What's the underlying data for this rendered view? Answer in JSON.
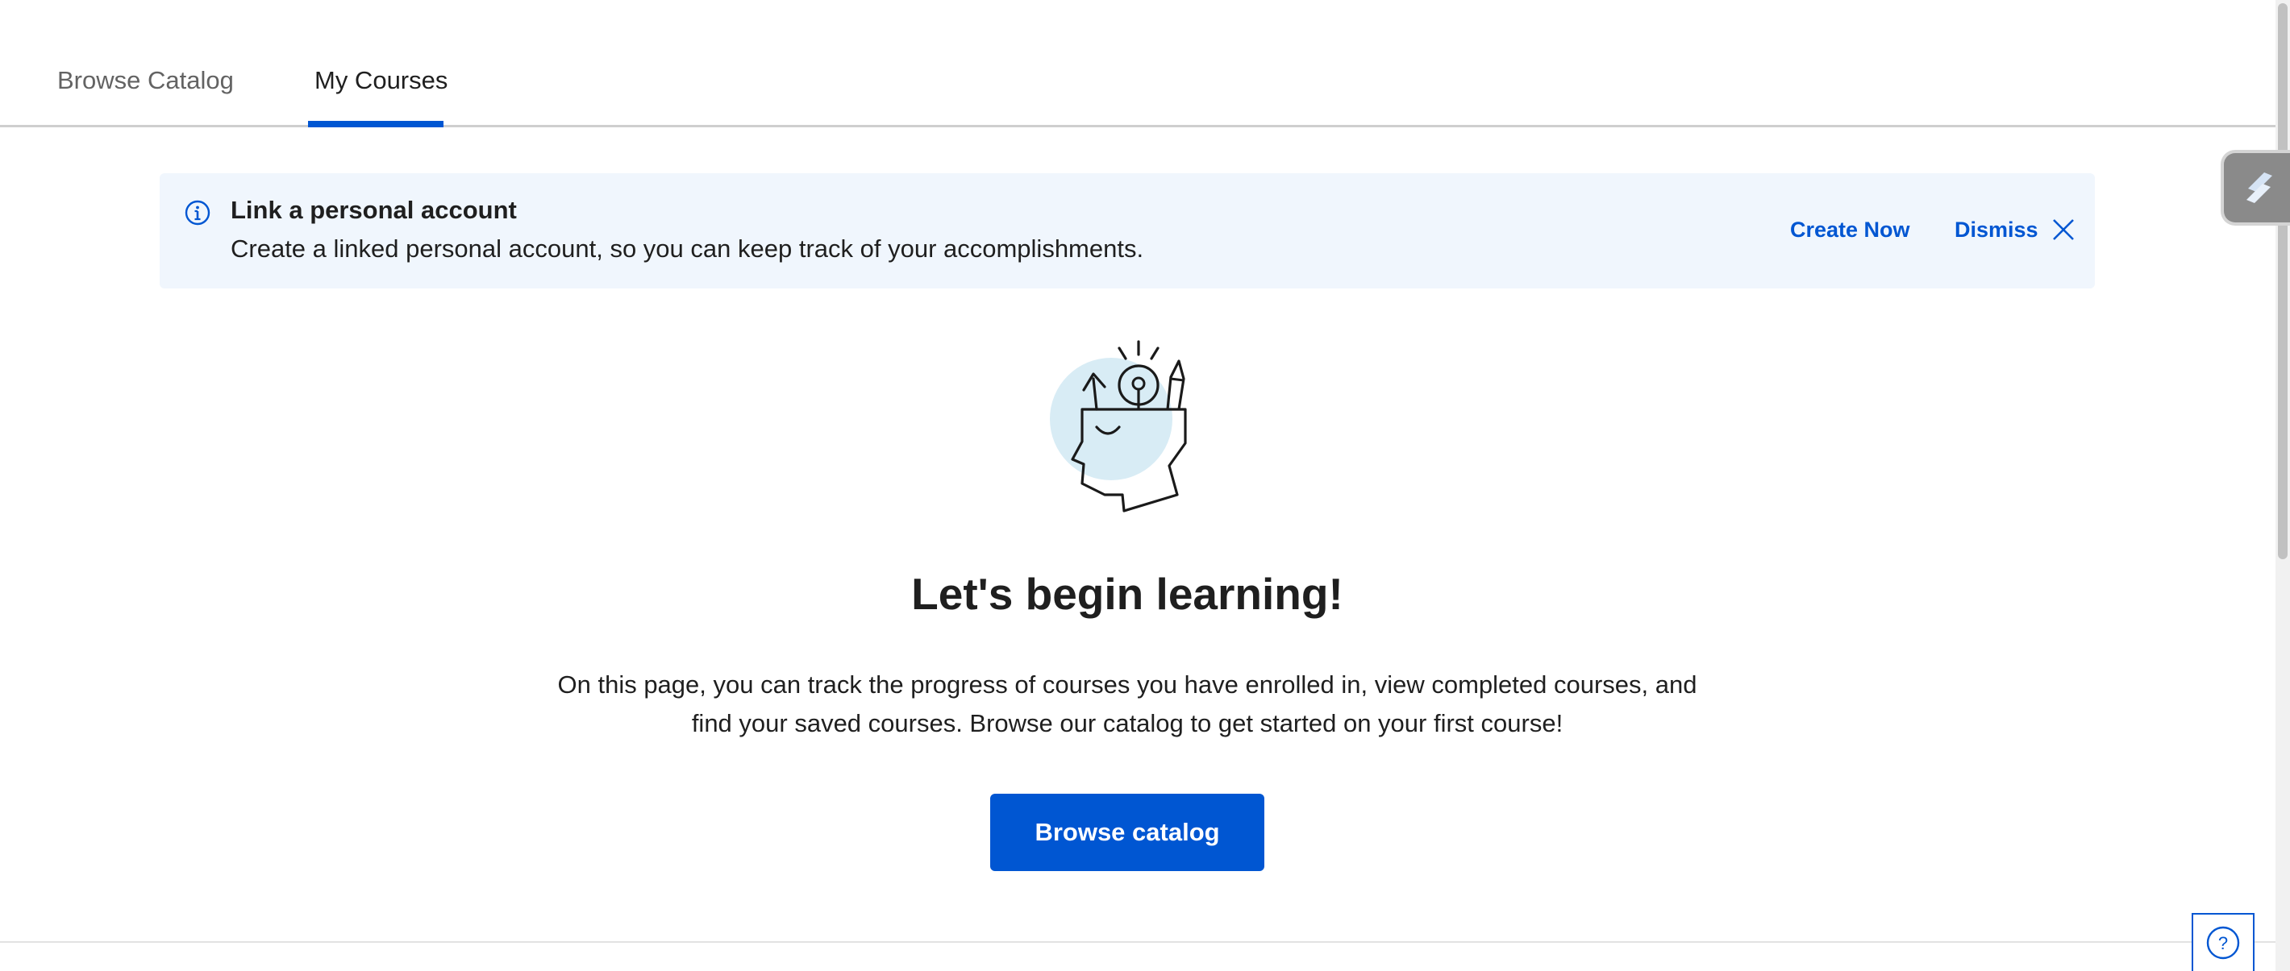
{
  "nav": {
    "tabs": [
      {
        "label": "Browse Catalog",
        "selected": false
      },
      {
        "label": "My Courses",
        "selected": true
      }
    ]
  },
  "banner": {
    "icon": "info-icon",
    "title": "Link a personal account",
    "text": "Create a linked personal account, so you can keep track of your accomplishments.",
    "create_label": "Create Now",
    "dismiss_label": "Dismiss",
    "close_icon": "close-icon"
  },
  "empty_state": {
    "illustration": "head-lightbulb-illustration",
    "heading": "Let's begin learning!",
    "description": "On this page, you can track the progress of courses you have enrolled in, view completed courses, and find your saved courses. Browse our catalog to get started on your first course!",
    "cta_label": "Browse catalog"
  },
  "help": {
    "icon": "question-icon",
    "label": "?"
  },
  "widget": {
    "icon": "app-widget-icon"
  },
  "colors": {
    "accent": "#0056d2",
    "banner_bg": "#f0f6fd",
    "text": "#1f1f1f",
    "muted_text": "#636363",
    "illustration_circle": "#d8ecf5"
  }
}
